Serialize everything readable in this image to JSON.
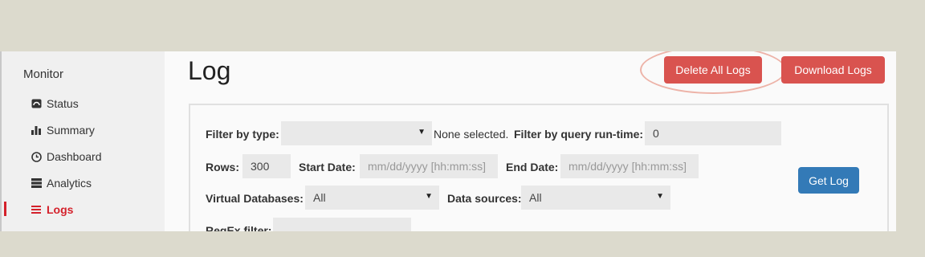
{
  "sidebar": {
    "heading": "Monitor",
    "items": [
      {
        "label": "Status",
        "icon": "speedometer-icon"
      },
      {
        "label": "Summary",
        "icon": "bar-chart-icon"
      },
      {
        "label": "Dashboard",
        "icon": "clock-icon"
      },
      {
        "label": "Analytics",
        "icon": "server-icon"
      },
      {
        "label": "Logs",
        "icon": "list-icon",
        "active": true
      }
    ]
  },
  "page": {
    "title": "Log",
    "delete_all_label": "Delete All Logs",
    "download_label": "Download Logs"
  },
  "filters": {
    "type_label": "Filter by type:",
    "type_value": "",
    "type_summary": "None selected.",
    "runtime_label": "Filter by query run-time:",
    "runtime_value": "0",
    "rows_label": "Rows:",
    "rows_value": "300",
    "start_label": "Start Date:",
    "start_placeholder": "mm/dd/yyyy [hh:mm:ss]",
    "end_label": "End Date:",
    "end_placeholder": "mm/dd/yyyy [hh:mm:ss]",
    "vdb_label": "Virtual Databases:",
    "vdb_value": "All",
    "ds_label": "Data sources:",
    "ds_value": "All",
    "regex_label": "RegEx filter:",
    "get_log_label": "Get Log"
  },
  "colors": {
    "danger": "#d9534f",
    "primary": "#337ab7",
    "active": "#d4212b"
  }
}
